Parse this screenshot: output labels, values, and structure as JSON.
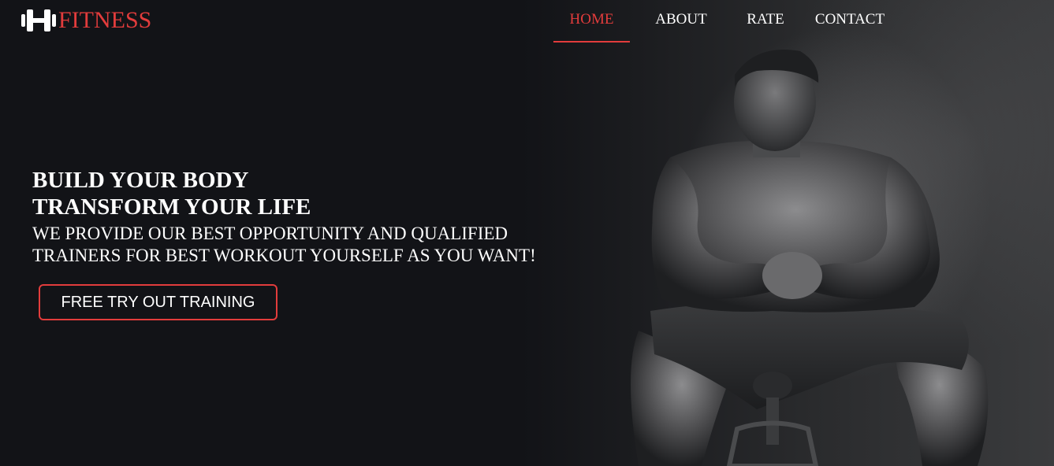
{
  "brand": {
    "name": "FITNESS",
    "accent_color": "#e23c3c",
    "icon": "dumbbell-h-icon"
  },
  "nav": {
    "items": [
      {
        "label": "HOME",
        "active": true
      },
      {
        "label": "ABOUT",
        "active": false
      },
      {
        "label": "RATE",
        "active": false
      },
      {
        "label": "CONTACT",
        "active": false
      }
    ]
  },
  "hero": {
    "headline_line1": "BUILD YOUR BODY",
    "headline_line2": "TRANSFORM YOUR LIFE",
    "subline_line1": "WE PROVIDE OUR BEST OPPORTUNITY AND QUALIFIED",
    "subline_line2": "TRAINERS FOR BEST WORKOUT YOURSELF AS YOU WANT!",
    "cta_label": "FREE TRY OUT TRAINING",
    "image": "bodybuilder-photo"
  },
  "colors": {
    "background": "#121317",
    "text": "#ffffff"
  }
}
